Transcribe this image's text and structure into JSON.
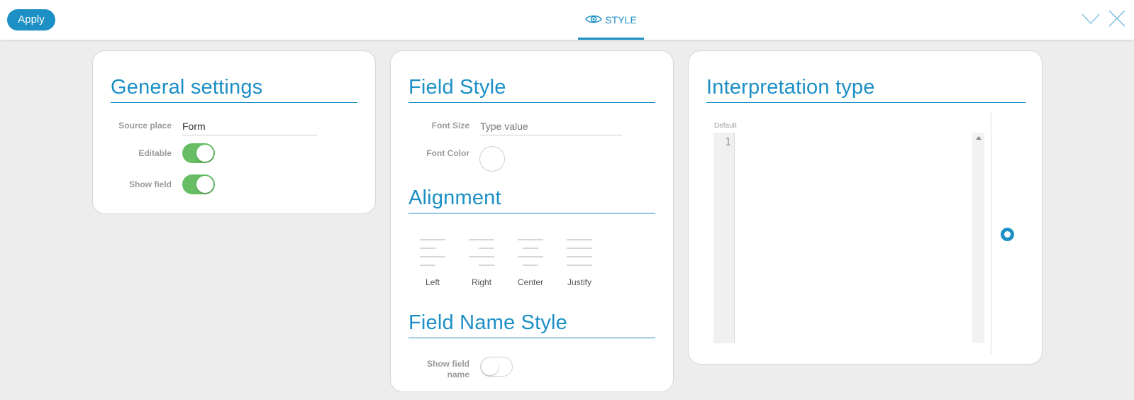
{
  "toolbar": {
    "apply_label": "Apply",
    "tab_label": "STYLE",
    "accent_color": "#1c8fc5",
    "icons": [
      "eye-icon",
      "chevron-down-icon",
      "close-icon"
    ]
  },
  "general_settings": {
    "title": "General settings",
    "source_place_label": "Source place",
    "source_place_value": "Form",
    "editable_label": "Editable",
    "editable_on": true,
    "show_field_label": "Show field",
    "show_field_on": true
  },
  "field_style": {
    "title": "Field Style",
    "font_size_label": "Font Size",
    "font_size_placeholder": "Type value",
    "font_color_label": "Font Color",
    "alignment_title": "Alignment",
    "alignments": [
      {
        "label": "Left"
      },
      {
        "label": "Right"
      },
      {
        "label": "Center"
      },
      {
        "label": "Justify"
      }
    ],
    "field_name_style_title": "Field Name Style",
    "show_field_name_label_line1": "Show field",
    "show_field_name_label_line2": "name",
    "show_field_name_on": false
  },
  "interpretation": {
    "title": "Interpretation type",
    "editor_caption": "Default",
    "line_number": "1"
  },
  "colors": {
    "toggle_on": "#66bd63",
    "background": "#ededee"
  }
}
